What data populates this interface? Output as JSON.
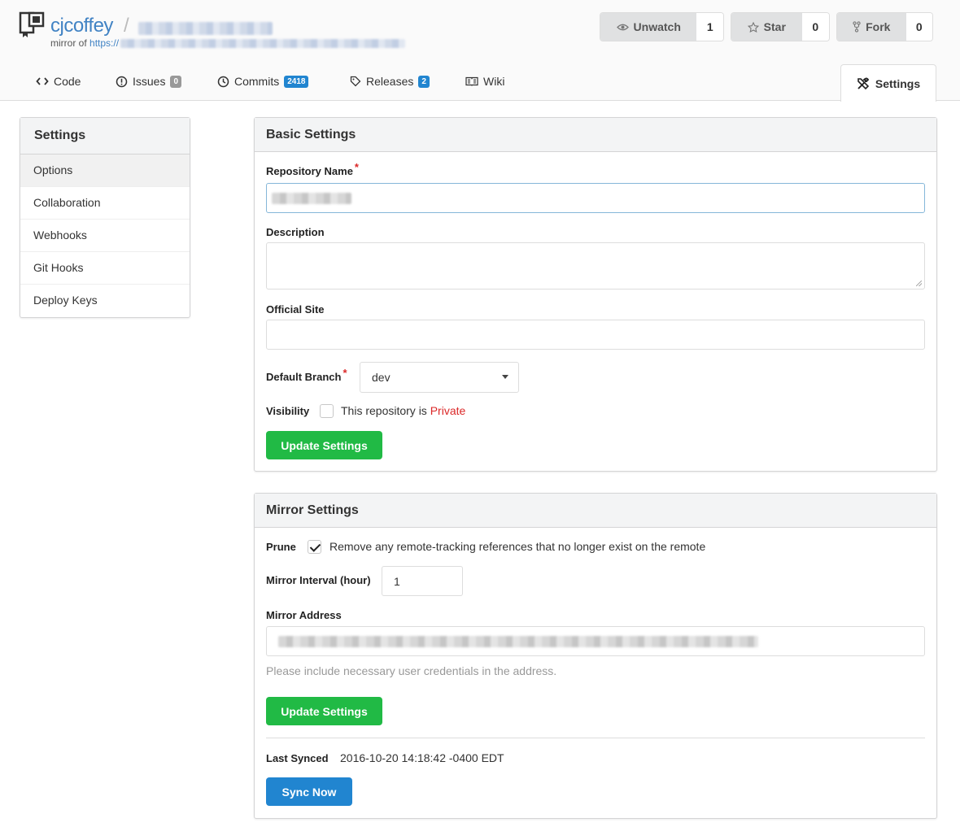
{
  "header": {
    "owner": "cjcoffey",
    "separator": "/",
    "mirror_prefix": "mirror of",
    "mirror_url_prefix": "https://",
    "watch": {
      "label": "Unwatch",
      "count": "1"
    },
    "star": {
      "label": "Star",
      "count": "0"
    },
    "fork": {
      "label": "Fork",
      "count": "0"
    }
  },
  "tabs": {
    "code": "Code",
    "issues": {
      "label": "Issues",
      "count": "0"
    },
    "commits": {
      "label": "Commits",
      "count": "2418"
    },
    "releases": {
      "label": "Releases",
      "count": "2"
    },
    "wiki": "Wiki",
    "settings": "Settings"
  },
  "sidebar": {
    "title": "Settings",
    "items": [
      "Options",
      "Collaboration",
      "Webhooks",
      "Git Hooks",
      "Deploy Keys"
    ]
  },
  "basic": {
    "title": "Basic Settings",
    "repo_name_label": "Repository Name",
    "required_mark": "*",
    "description_label": "Description",
    "official_site_label": "Official Site",
    "default_branch_label": "Default Branch",
    "default_branch_value": "dev",
    "visibility_label": "Visibility",
    "visibility_text": "This repository is",
    "visibility_private": "Private",
    "visibility_checked": false,
    "update_button": "Update Settings"
  },
  "mirror": {
    "title": "Mirror Settings",
    "prune_label": "Prune",
    "prune_text": "Remove any remote-tracking references that no longer exist on the remote",
    "prune_checked": true,
    "interval_label": "Mirror Interval (hour)",
    "interval_value": "1",
    "address_label": "Mirror Address",
    "address_hint": "Please include necessary user credentials in the address.",
    "update_button": "Update Settings",
    "last_synced_label": "Last Synced",
    "last_synced_value": "2016-10-20 14:18:42 -0400 EDT",
    "sync_button": "Sync Now"
  },
  "colors": {
    "link": "#4183c4",
    "green": "#21ba45",
    "blue": "#2185d0",
    "required": "#db2828"
  }
}
